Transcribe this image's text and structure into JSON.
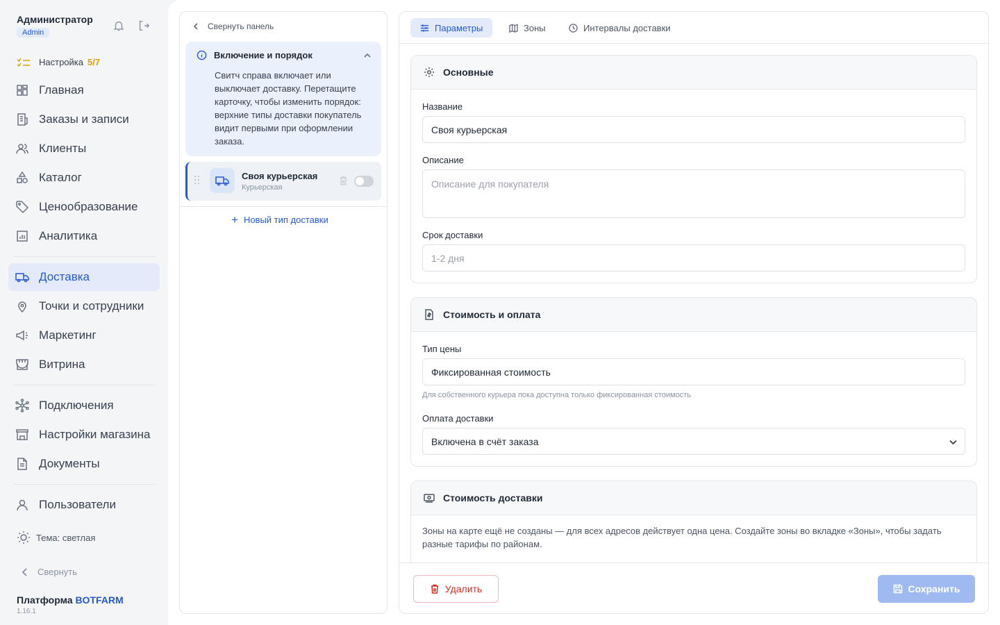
{
  "sidebar": {
    "user_name": "Администратор",
    "user_role": "Admin",
    "setup": {
      "label": "Настройка",
      "progress": "5/7"
    },
    "nav_group1": [
      {
        "label": "Главная",
        "icon": "grid-icon"
      },
      {
        "label": "Заказы и записи",
        "icon": "receipt-icon"
      },
      {
        "label": "Клиенты",
        "icon": "users-icon"
      },
      {
        "label": "Каталог",
        "icon": "shapes-icon"
      },
      {
        "label": "Ценообразование",
        "icon": "tag-icon"
      },
      {
        "label": "Аналитика",
        "icon": "chart-icon"
      }
    ],
    "nav_group2": [
      {
        "label": "Доставка",
        "icon": "truck-icon",
        "active": true
      },
      {
        "label": "Точки и сотрудники",
        "icon": "map-pin-icon"
      },
      {
        "label": "Маркетинг",
        "icon": "megaphone-icon"
      },
      {
        "label": "Витрина",
        "icon": "storefront-icon"
      }
    ],
    "nav_group3": [
      {
        "label": "Подключения",
        "icon": "network-icon"
      },
      {
        "label": "Настройки магазина",
        "icon": "store-icon"
      },
      {
        "label": "Документы",
        "icon": "document-icon"
      }
    ],
    "nav_group4": [
      {
        "label": "Пользователи",
        "icon": "user-icon"
      }
    ],
    "theme_label": "Тема: светлая",
    "collapse_label": "Свернуть",
    "brand_prefix": "Платформа",
    "brand_name": "BOTFARM",
    "version": "1.16.1"
  },
  "middle": {
    "collapse_label": "Свернуть панель",
    "info_title": "Включение и порядок",
    "info_text": "Свитч справа включает или выключает доставку. Перетащите карточку, чтобы изменить порядок: верхние типы доставки покупатель видит первыми при оформлении заказа.",
    "delivery_item": {
      "title": "Своя курьерская",
      "subtitle": "Курьерская",
      "enabled": false
    },
    "new_type_label": "Новый тип доставки"
  },
  "tabs": [
    {
      "label": "Параметры",
      "active": true
    },
    {
      "label": "Зоны",
      "active": false
    },
    {
      "label": "Интервалы доставки",
      "active": false
    }
  ],
  "sections": {
    "basic": {
      "title": "Основные",
      "name_label": "Название",
      "name_value": "Своя курьерская",
      "description_label": "Описание",
      "description_placeholder": "Описание для покупателя",
      "term_label": "Срок доставки",
      "term_placeholder": "1-2 дня"
    },
    "cost_payment": {
      "title": "Стоимость и оплата",
      "price_type_label": "Тип цены",
      "price_type_value": "Фиксированная стоимость",
      "price_type_hint": "Для собственного курьера пока доступна только фиксированная стоимость",
      "payment_label": "Оплата доставки",
      "payment_value": "Включена в счёт заказа"
    },
    "delivery_cost": {
      "title": "Стоимость доставки",
      "text": "Зоны на карте ещё не созданы — для всех адресов действует одна цена. Создайте зоны во вкладке «Зоны», чтобы задать разные тарифы по районам."
    }
  },
  "footer": {
    "delete_label": "Удалить",
    "save_label": "Сохранить"
  },
  "colors": {
    "accent": "#2557d6",
    "danger": "#d92d20",
    "progress": "#e0a100"
  }
}
